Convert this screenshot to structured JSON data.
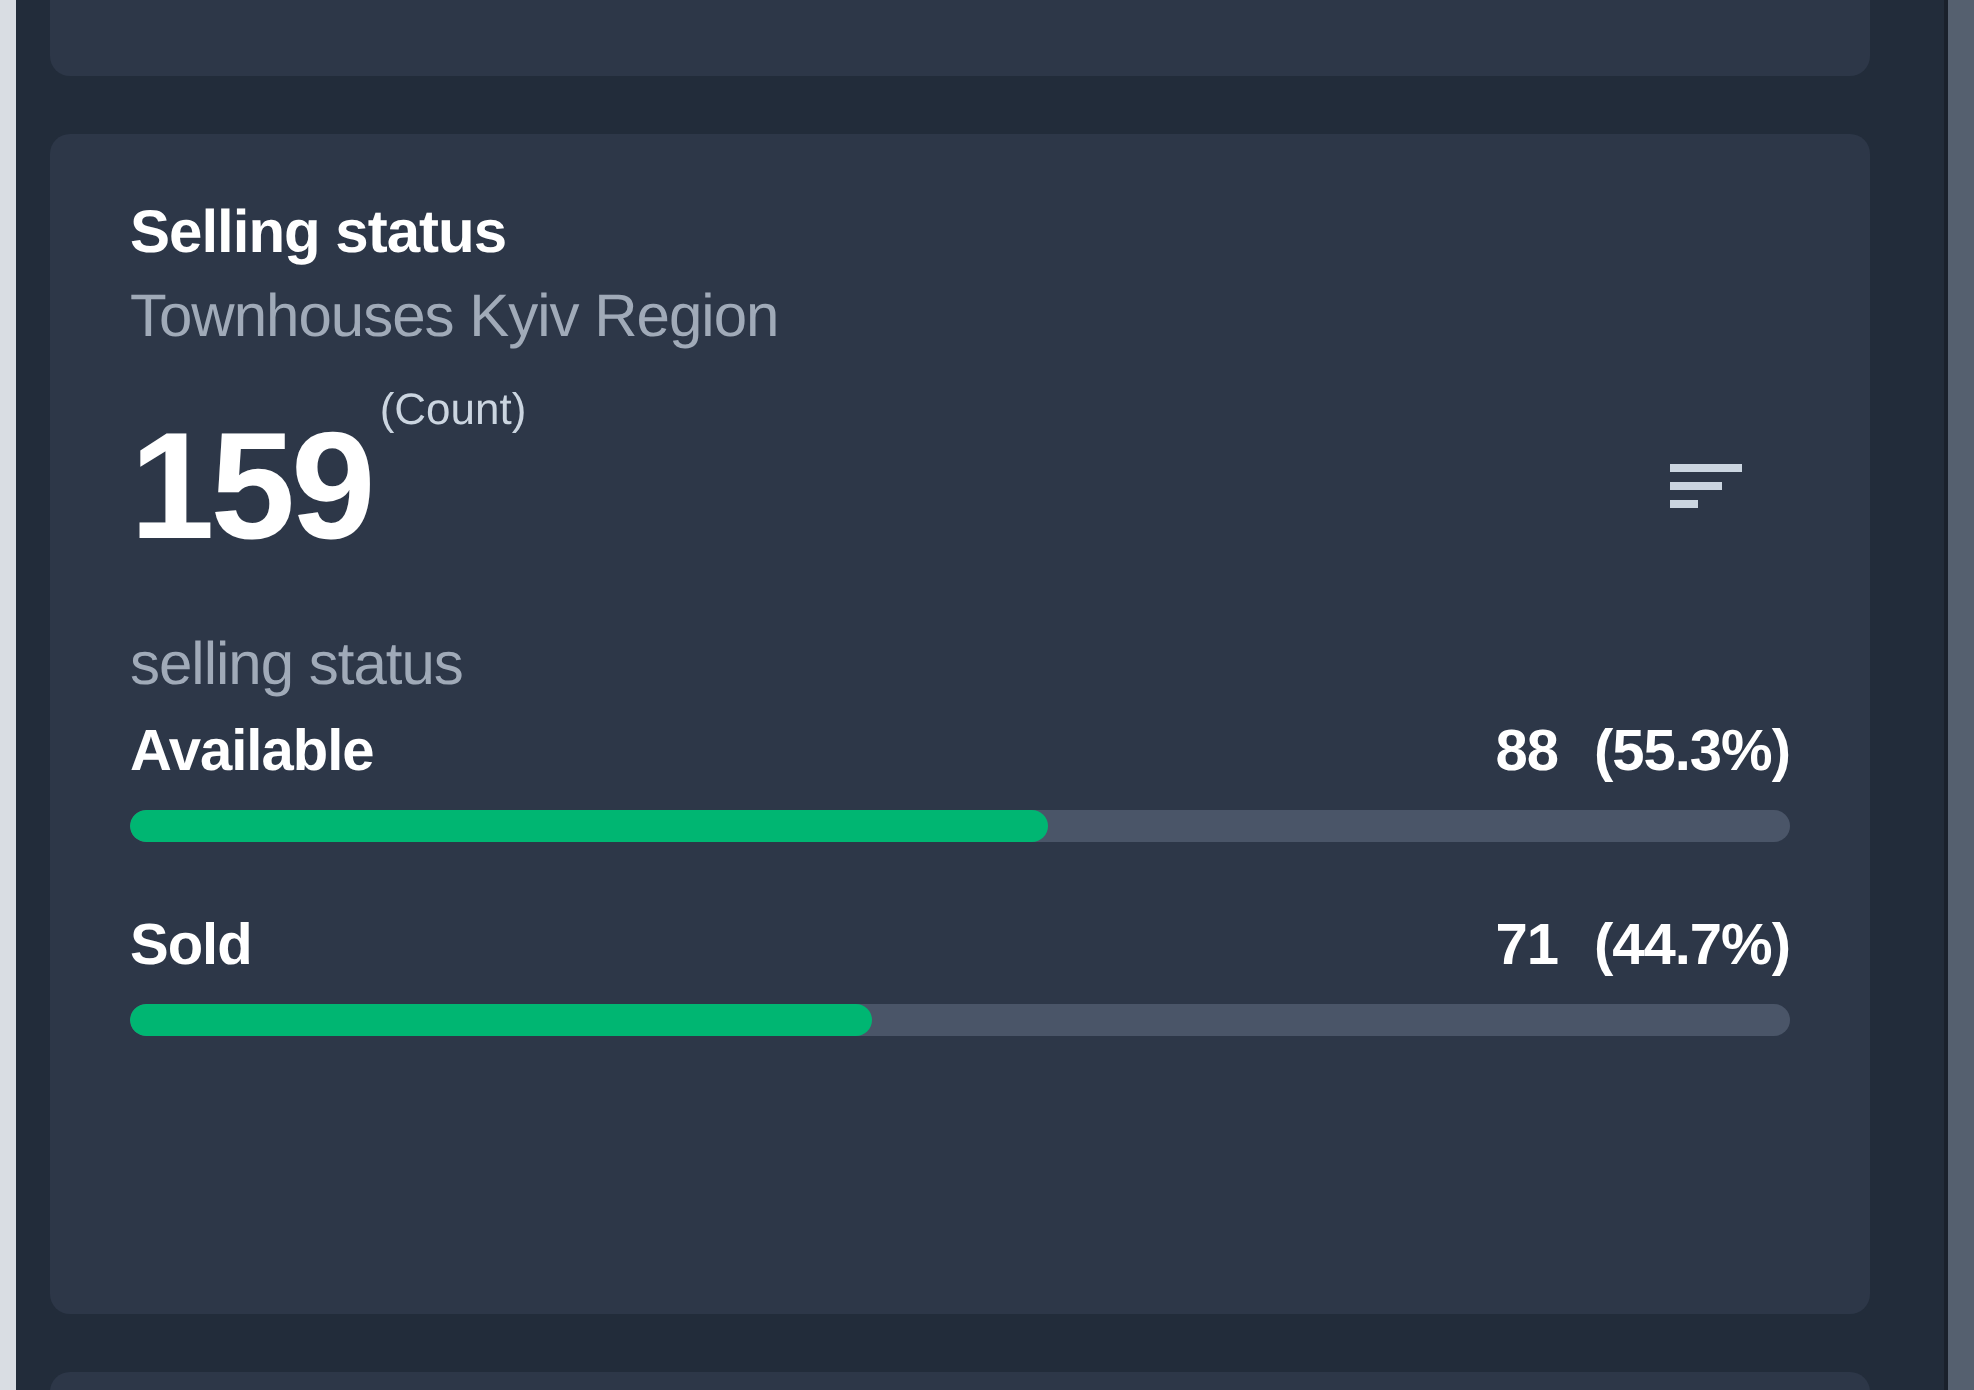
{
  "card": {
    "title": "Selling status",
    "subtitle": "Townhouses Kyiv Region",
    "total": "159",
    "total_unit": "(Count)",
    "metric_label": "selling status",
    "rows": [
      {
        "label": "Available",
        "count": "88",
        "percent": "(55.3%)",
        "level": 0.553
      },
      {
        "label": "Sold",
        "count": "71",
        "percent": "(44.7%)",
        "level": 0.447
      }
    ]
  }
}
